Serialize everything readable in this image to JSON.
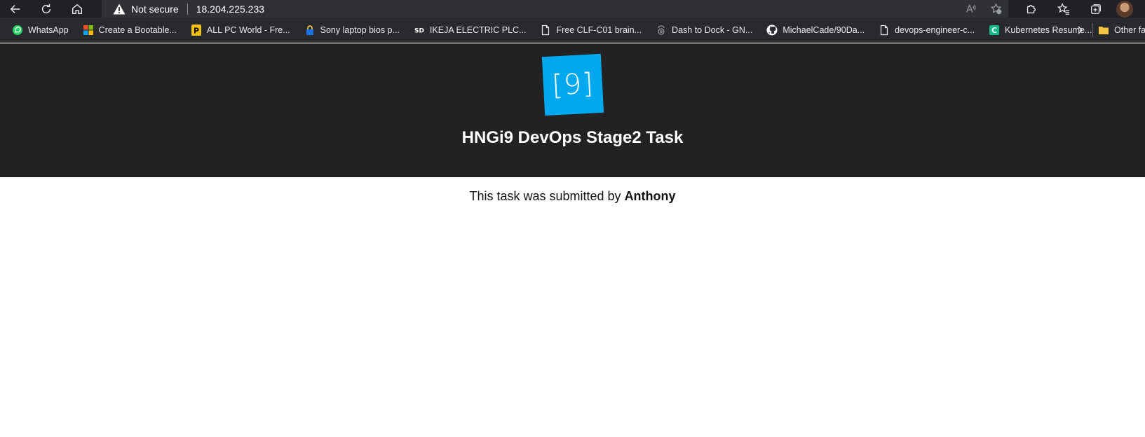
{
  "browser": {
    "security_label": "Not secure",
    "url": "18.204.225.233"
  },
  "bookmarks": [
    {
      "label": "WhatsApp",
      "icon": "whatsapp-icon",
      "color": "#25d366"
    },
    {
      "label": "Create a Bootable...",
      "icon": "microsoft-icon",
      "color": "#f25022"
    },
    {
      "label": "ALL PC World - Fre...",
      "icon": "allpcworld-icon",
      "color": "#f5c400"
    },
    {
      "label": "Sony laptop bios p...",
      "icon": "lock-icon",
      "color": "#1a73e8"
    },
    {
      "label": "IKEJA ELECTRIC PLC...",
      "icon": "sd-icon",
      "color": "#ffffff"
    },
    {
      "label": "Free CLF-C01 brain...",
      "icon": "document-icon",
      "color": "#e8eaed"
    },
    {
      "label": "Dash to Dock - GN...",
      "icon": "gnome-icon",
      "color": "#9aa0a6"
    },
    {
      "label": "MichaelCade/90Da...",
      "icon": "github-icon",
      "color": "#ffffff"
    },
    {
      "label": "devops-engineer-c...",
      "icon": "document-icon",
      "color": "#e8eaed"
    },
    {
      "label": "Kubernetes Resume...",
      "icon": "c-logo-icon",
      "color": "#12b886"
    }
  ],
  "bookmarks_other": "Other fa",
  "page": {
    "logo_text": "[9]",
    "title": "HNGi9 DevOps Stage2 Task",
    "submitted_prefix": "This task was submitted by",
    "submitted_name": "Anthony",
    "logo_color": "#00a8ed",
    "header_bg": "#222222"
  }
}
